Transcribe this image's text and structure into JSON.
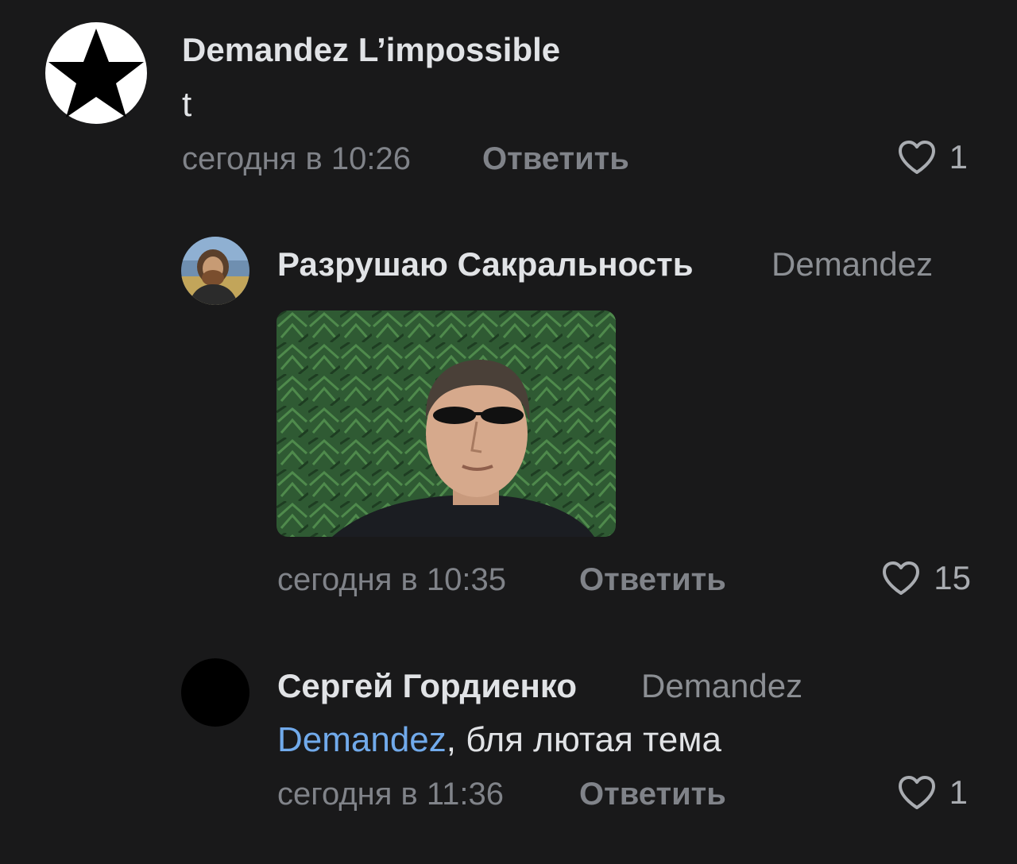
{
  "comments": [
    {
      "author": "Demandez L’impossible",
      "text": "t",
      "time": "сегодня в 10:26",
      "reply_label": "Ответить",
      "likes": "1",
      "avatar_icon": "black-star-icon"
    },
    {
      "author": "Разрушаю Сакральность",
      "reply_to": "Demandez",
      "time": "сегодня в 10:35",
      "reply_label": "Ответить",
      "likes": "15",
      "avatar_icon": "user-photo-avatar"
    },
    {
      "author": "Сергей Гордиенко",
      "reply_to": "Demandez",
      "mention": "Demandez",
      "text": ", бля лютая тема",
      "time": "сегодня в 11:36",
      "reply_label": "Ответить",
      "likes": "1",
      "avatar_icon": "user-avatar"
    }
  ],
  "colors": {
    "background": "#19191a",
    "primary_text": "#e1e3e6",
    "secondary_text": "#808389",
    "mention": "#71aaeb"
  },
  "icons": {
    "like": "heart-outline-icon"
  }
}
